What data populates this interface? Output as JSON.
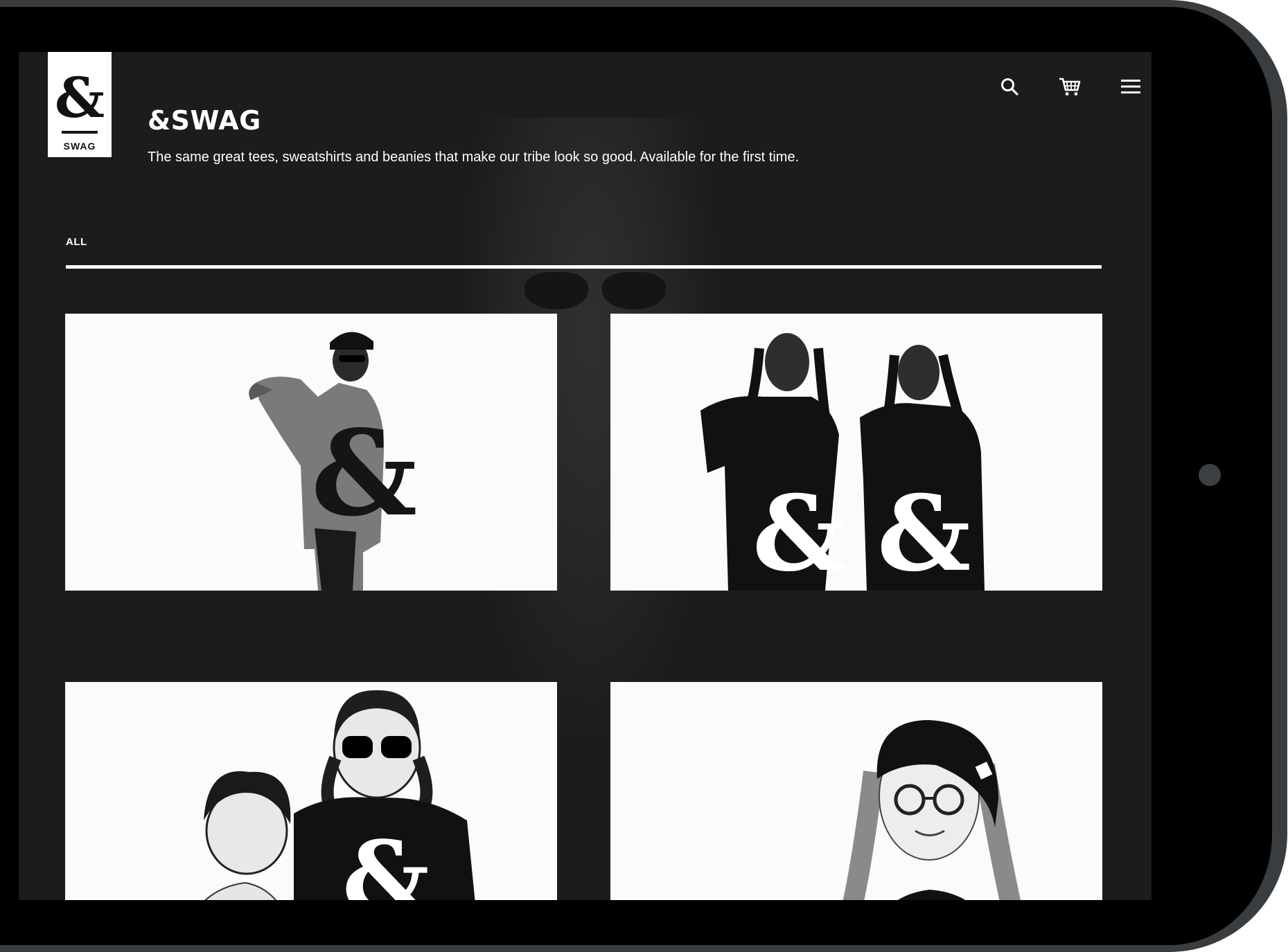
{
  "brand": {
    "logo_symbol": "&",
    "logo_text": "SWAG",
    "title": "&SWAG",
    "tagline": "The same great tees, sweatshirts and beanies that make our tribe look so good. Available for the first time."
  },
  "header_icons": [
    "search-icon",
    "cart-icon",
    "menu-icon"
  ],
  "filters": {
    "active": "ALL"
  },
  "products": [
    {
      "name": "product-sweatshirt",
      "depicts": "man in gray ampersand sweatshirt"
    },
    {
      "name": "product-tees",
      "depicts": "two women in black ampersand tees"
    },
    {
      "name": "product-kids-tee",
      "depicts": "two kids, ampersand tee"
    },
    {
      "name": "product-beanie",
      "depicts": "woman in black beanie"
    }
  ],
  "colors": {
    "screen_bg": "#1c1c1d",
    "bezel": "#000000",
    "bezel_edge": "#3a3d40",
    "text": "#ffffff"
  }
}
